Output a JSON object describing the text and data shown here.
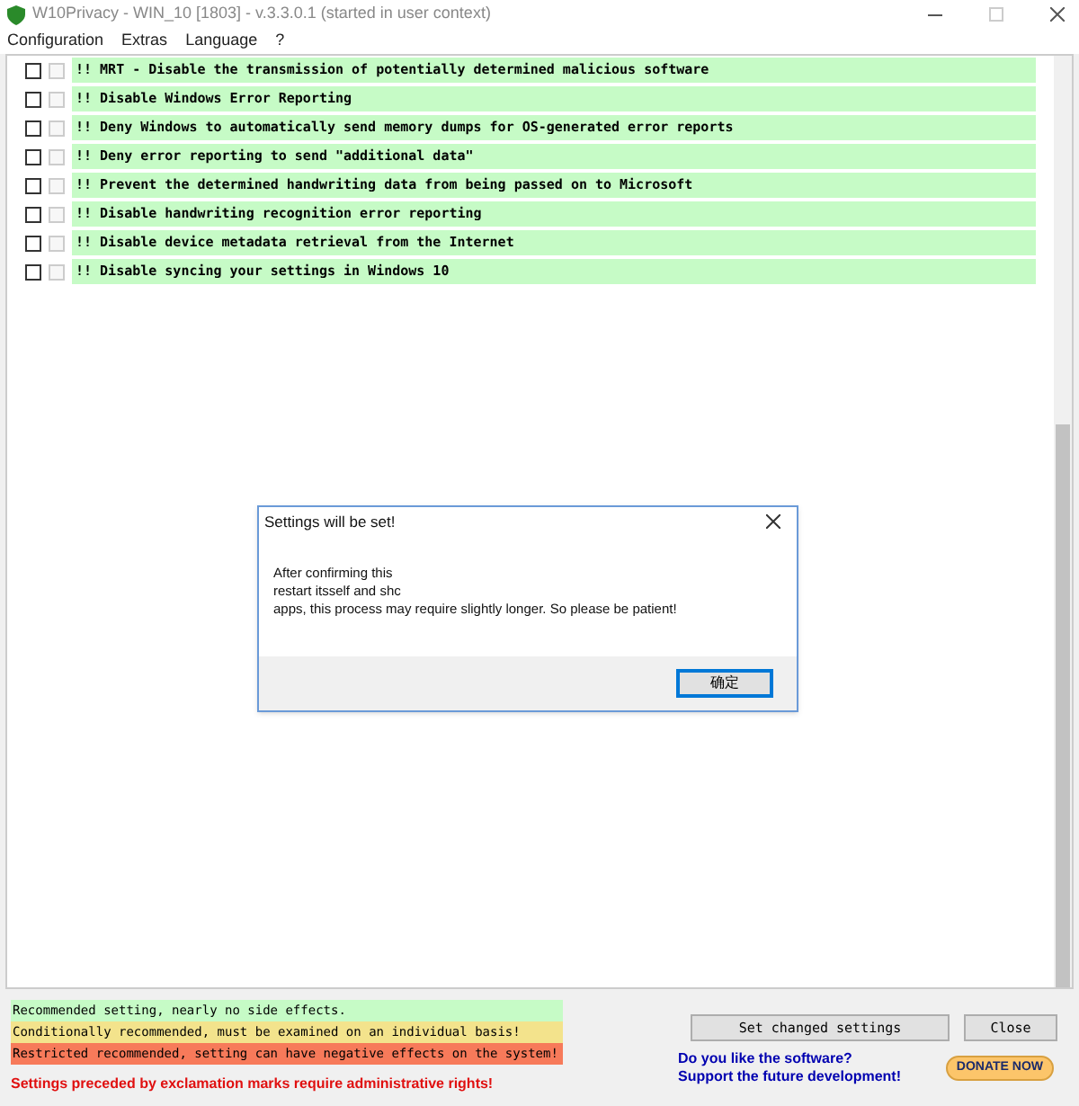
{
  "window": {
    "title": "W10Privacy - WIN_10 [1803]  - v.3.3.0.1 (started in user context)"
  },
  "menu": [
    "Configuration",
    "Extras",
    "Language",
    "?"
  ],
  "settings": [
    {
      "label": "!! MRT - Disable the transmission of potentially determined malicious software",
      "checked": false,
      "checked_2": false,
      "disabled_2": true,
      "color": "#c6fbc6"
    },
    {
      "label": "!! Disable Windows Error Reporting",
      "checked": false,
      "checked_2": false,
      "disabled_2": true,
      "color": "#c6fbc6"
    },
    {
      "label": "!! Deny Windows to automatically send memory dumps for OS-generated error reports",
      "checked": false,
      "checked_2": false,
      "disabled_2": true,
      "color": "#c6fbc6"
    },
    {
      "label": "!! Deny error reporting to send \"additional data\"",
      "checked": false,
      "checked_2": false,
      "disabled_2": true,
      "color": "#c6fbc6"
    },
    {
      "label": "!! Prevent the determined handwriting data from being passed on to Microsoft",
      "checked": false,
      "checked_2": false,
      "disabled_2": true,
      "color": "#c6fbc6"
    },
    {
      "label": "!! Disable handwriting recognition error reporting",
      "checked": false,
      "checked_2": false,
      "disabled_2": true,
      "color": "#c6fbc6"
    },
    {
      "label": "!! Disable device metadata retrieval from the Internet",
      "checked": false,
      "checked_2": false,
      "disabled_2": true,
      "color": "#c6fbc6"
    },
    {
      "label": "!! Disable syncing your settings in Windows 10",
      "checked": false,
      "checked_2": false,
      "disabled_2": true,
      "color": "#c6fbc6"
    }
  ],
  "dialog": {
    "title": "Settings will be set!",
    "lines": [
      "After confirming this",
      "restart itsself and shc",
      "apps, this process may require slightly longer. So please be patient!"
    ],
    "button": "确定"
  },
  "legend": [
    {
      "label": "Recommended setting, nearly no side effects.",
      "color": "#c6fbc6"
    },
    {
      "label": "Conditionally recommended, must be examined on an individual basis!",
      "color": "#f3e38c"
    },
    {
      "label": "Restricted recommended, setting can have negative effects on the system!",
      "color": "#f77a5a"
    }
  ],
  "admin_note": "Settings preceded by exclamation marks require administrative rights!",
  "buttons": {
    "apply": "Set changed settings",
    "close": "Close"
  },
  "support": [
    "Do you like the software?",
    "Support the future development!"
  ],
  "donate": "DONATE NOW"
}
